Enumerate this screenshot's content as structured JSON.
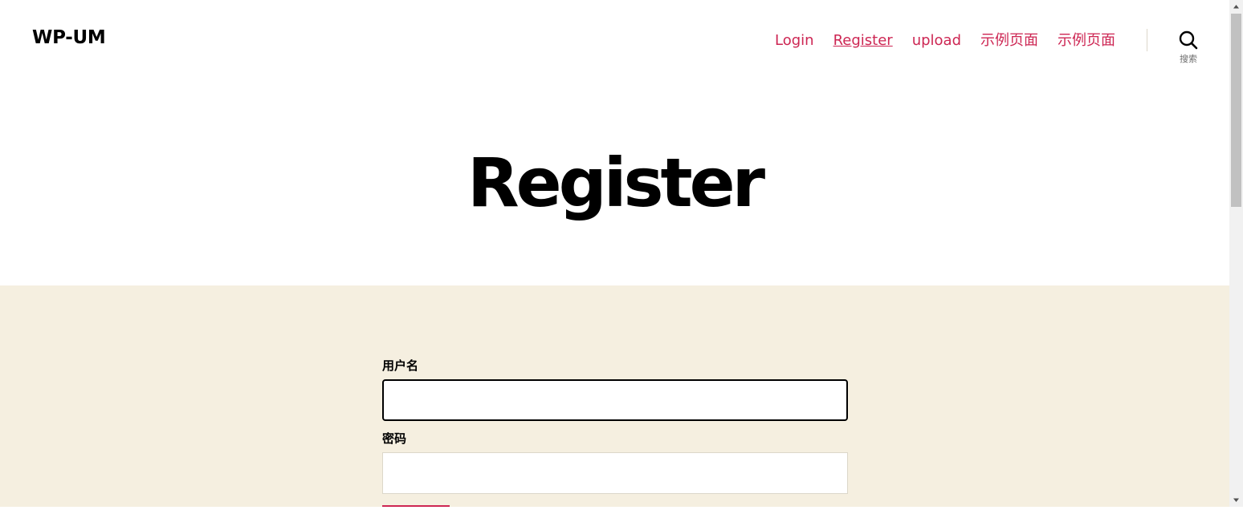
{
  "header": {
    "site_title": "WP-UM",
    "nav": [
      {
        "label": "Login"
      },
      {
        "label": "Register",
        "current": true
      },
      {
        "label": "upload"
      },
      {
        "label": "示例页面"
      },
      {
        "label": "示例页面"
      }
    ],
    "search": {
      "icon": "search-icon",
      "label": "搜索"
    }
  },
  "page": {
    "title": "Register"
  },
  "form": {
    "username": {
      "label": "用户名",
      "value": "",
      "focused": true
    },
    "password": {
      "label": "密码",
      "value": ""
    }
  },
  "colors": {
    "accent": "#cd2653",
    "content_background": "#f5efe0",
    "text": "#000000",
    "border": "#dcd7ca"
  }
}
